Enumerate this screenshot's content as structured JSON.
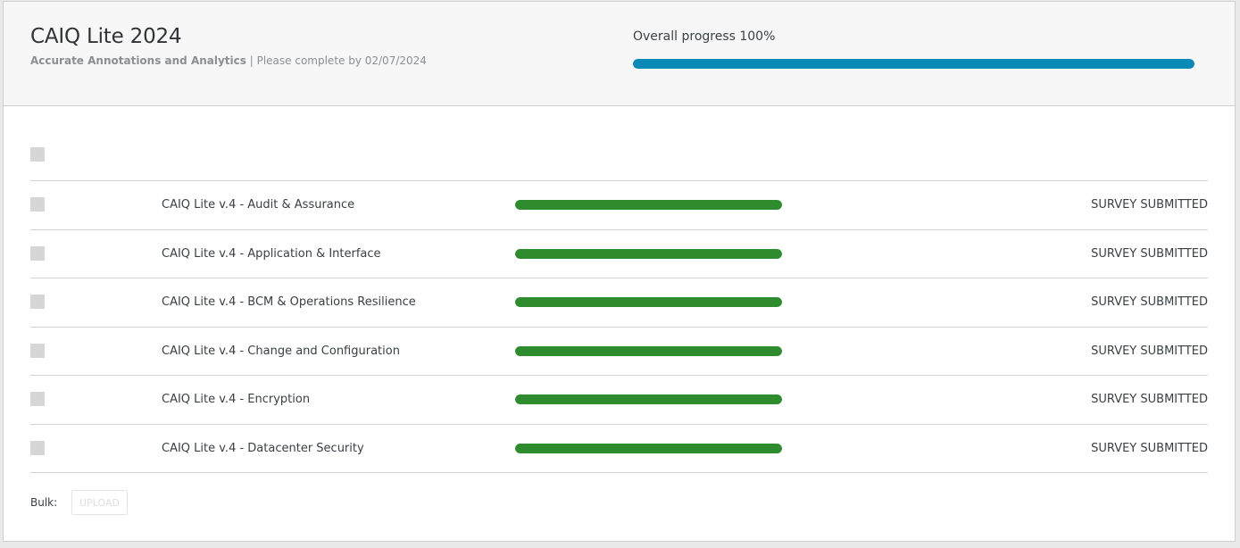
{
  "header": {
    "title": "CAIQ Lite 2024",
    "organization": "Accurate Annotations and Analytics",
    "separator": " | ",
    "due_text": "Please complete by 02/07/2024",
    "progress_label": "Overall progress 100%",
    "progress_percent": 100
  },
  "colors": {
    "overall_progress": "#0b8ab8",
    "row_progress": "#2e8b2e"
  },
  "surveys": [
    {
      "label": "CAIQ Lite v.4 - Audit & Assurance",
      "progress_percent": 100,
      "status": "SURVEY SUBMITTED"
    },
    {
      "label": "CAIQ Lite v.4 - Application & Interface",
      "progress_percent": 100,
      "status": "SURVEY SUBMITTED"
    },
    {
      "label": "CAIQ Lite v.4 - BCM & Operations Resilience",
      "progress_percent": 100,
      "status": "SURVEY SUBMITTED"
    },
    {
      "label": "CAIQ Lite v.4 - Change and Configuration",
      "progress_percent": 100,
      "status": "SURVEY SUBMITTED"
    },
    {
      "label": "CAIQ Lite v.4 - Encryption",
      "progress_percent": 100,
      "status": "SURVEY SUBMITTED"
    },
    {
      "label": "CAIQ Lite v.4 - Datacenter Security",
      "progress_percent": 100,
      "status": "SURVEY SUBMITTED"
    }
  ],
  "footer": {
    "bulk_label": "Bulk:",
    "upload_label": "UPLOAD"
  }
}
